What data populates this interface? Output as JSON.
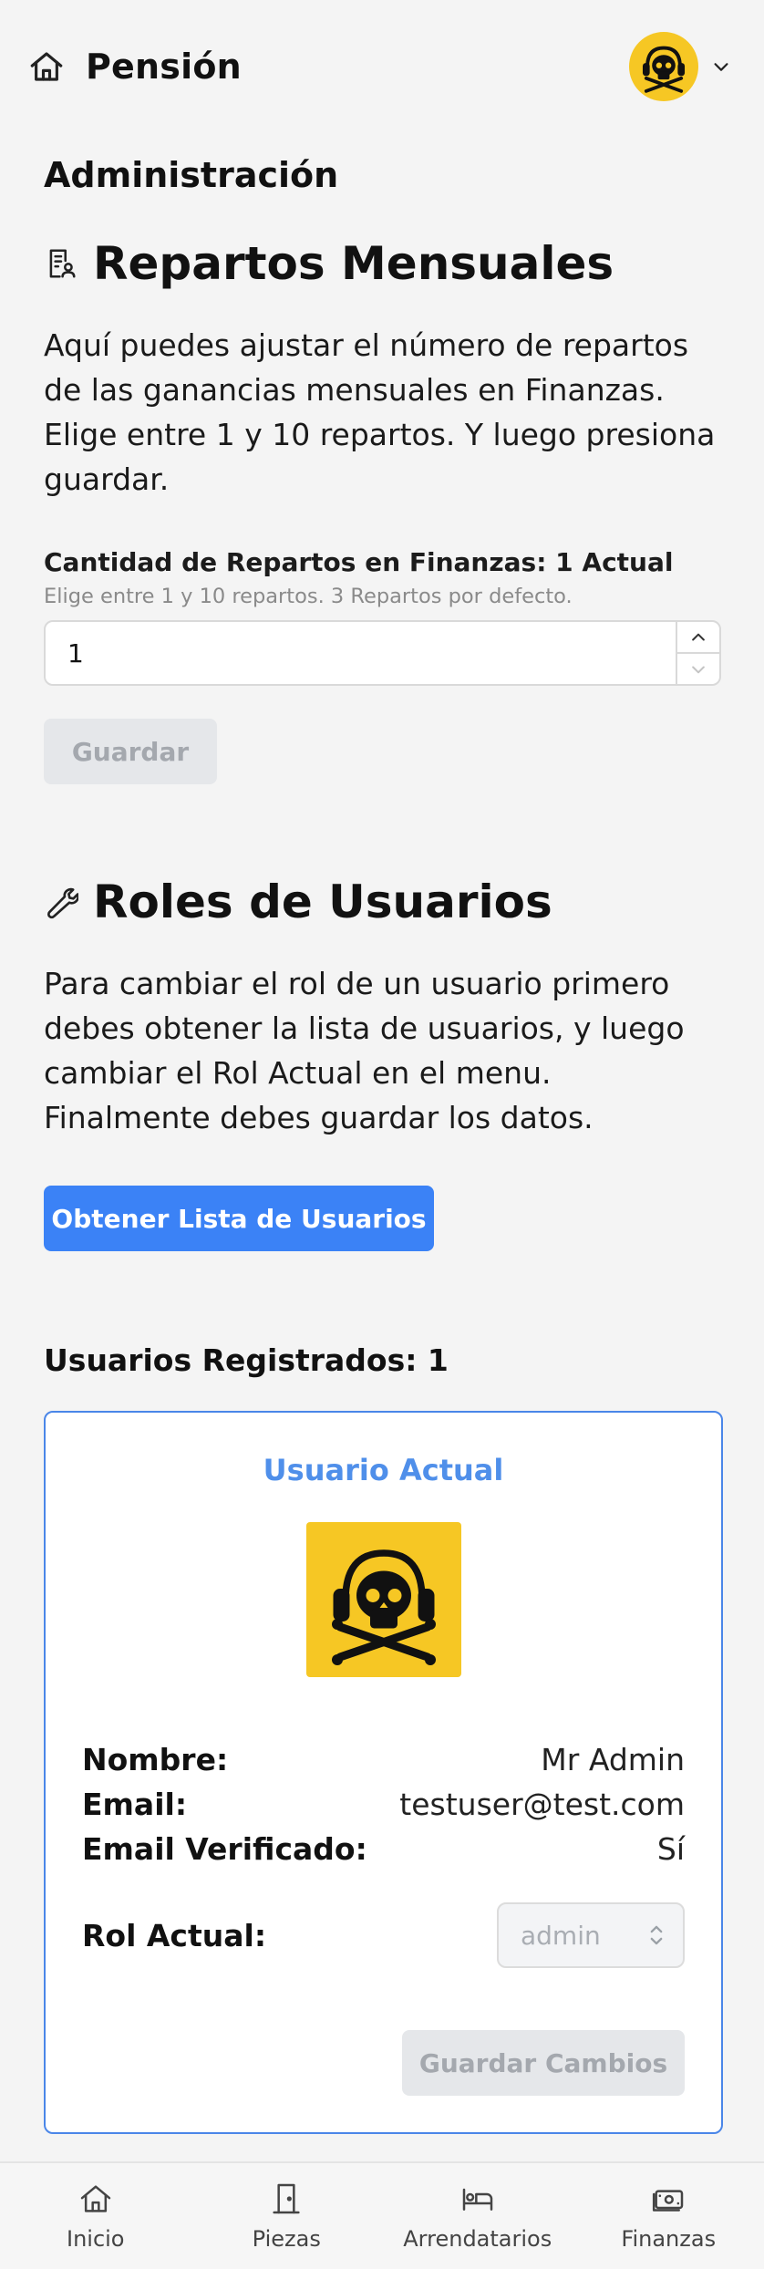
{
  "header": {
    "title": "Pensión",
    "home_icon": "home-icon",
    "avatar_icon": "skull-headphones-avatar",
    "menu_icon": "chevron-down-icon"
  },
  "admin": {
    "title": "Administración"
  },
  "repartos": {
    "title": "Repartos Mensuales",
    "icon": "receipt-user-icon",
    "description": "Aquí puedes ajustar el número de repartos de las ganancias mensuales en Finanzas. Elige entre 1 y 10 repartos. Y luego presiona guardar.",
    "field_label": "Cantidad de Repartos en Finanzas: 1 Actual",
    "field_help": "Elige entre 1 y 10 repartos. 3 Repartos por defecto.",
    "input_value": "1",
    "save_label": "Guardar"
  },
  "roles": {
    "title": "Roles de Usuarios",
    "icon": "wrench-icon",
    "description": "Para cambiar el rol de un usuario primero debes obtener la lista de usuarios, y luego cambiar el Rol Actual en el menu. Finalmente debes guardar los datos.",
    "fetch_label": "Obtener Lista de Usuarios",
    "registered_label": "Usuarios Registrados: 1"
  },
  "user_card": {
    "title": "Usuario Actual",
    "rows": [
      {
        "key": "Nombre:",
        "value": "Mr Admin"
      },
      {
        "key": "Email:",
        "value": "testuser@test.com"
      },
      {
        "key": "Email Verificado:",
        "value": "Sí"
      }
    ],
    "role_label": "Rol Actual:",
    "role_value": "admin",
    "save_changes_label": "Guardar Cambios"
  },
  "bottom_nav": {
    "items": [
      {
        "label": "Inicio",
        "icon": "home-icon"
      },
      {
        "label": "Piezas",
        "icon": "door-icon"
      },
      {
        "label": "Arrendatarios",
        "icon": "bed-icon"
      },
      {
        "label": "Finanzas",
        "icon": "money-icon"
      }
    ]
  },
  "colors": {
    "accent": "#3b82f6",
    "card_border": "#4a86e8",
    "card_title": "#4f8fea",
    "avatar_bg": "#f6c724",
    "disabled_bg": "#e5e7ea",
    "disabled_text": "#a4a8ae"
  }
}
